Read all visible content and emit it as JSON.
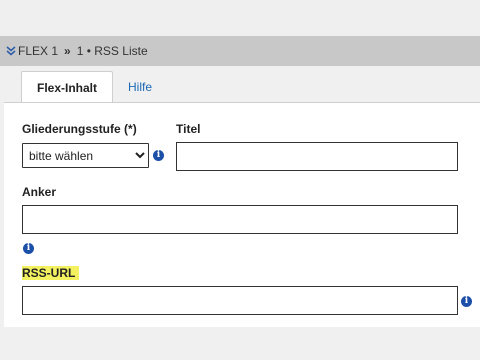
{
  "breadcrumb": {
    "section": "FLEX 1",
    "separator": "»",
    "item": "1 • RSS Liste"
  },
  "tabs": [
    {
      "label": "Flex-Inhalt",
      "active": true
    },
    {
      "label": "Hilfe",
      "active": false
    }
  ],
  "form": {
    "outline_level": {
      "label": "Gliederungsstufe",
      "required_mark": "(*)",
      "selected": "bitte wählen"
    },
    "title": {
      "label": "Titel",
      "value": ""
    },
    "anchor": {
      "label": "Anker",
      "value": ""
    },
    "rss_url": {
      "label": "RSS-URL",
      "value": "",
      "highlight_color": "#f4f160"
    }
  },
  "colors": {
    "link": "#1c69b5",
    "info_icon": "#1b4fa8"
  }
}
